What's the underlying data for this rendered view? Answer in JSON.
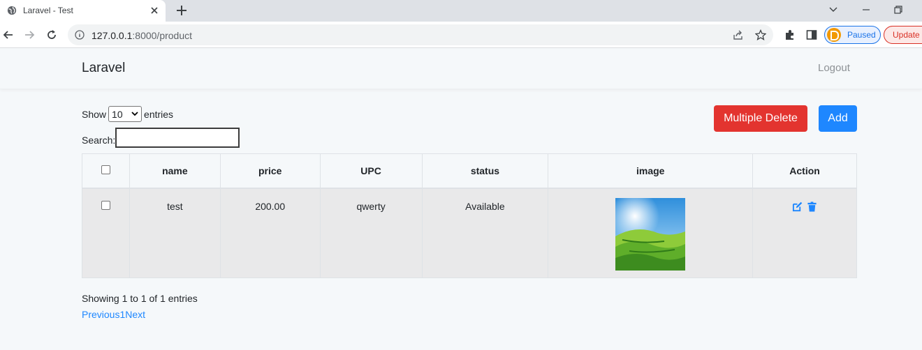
{
  "browser": {
    "tab_title": "Laravel - Test",
    "url_host": "127.0.0.1",
    "url_rest": ":8000/product",
    "profile_label": "Paused",
    "update_label": "Update"
  },
  "navbar": {
    "brand": "Laravel",
    "logout": "Logout"
  },
  "controls": {
    "show_label": "Show",
    "entries_label": "entries",
    "length_value": "10",
    "search_label": "Search:",
    "multiple_delete": "Multiple Delete",
    "add": "Add"
  },
  "table": {
    "headers": [
      "name",
      "price",
      "UPC",
      "status",
      "image",
      "Action"
    ],
    "rows": [
      {
        "name": "test",
        "price": "200.00",
        "upc": "qwerty",
        "status": "Available"
      }
    ]
  },
  "footer": {
    "info": "Showing 1 to 1 of 1 entries",
    "previous": "Previous",
    "page": "1",
    "next": "Next"
  },
  "colors": {
    "danger": "#e3342f",
    "primary": "#1e87ff"
  }
}
